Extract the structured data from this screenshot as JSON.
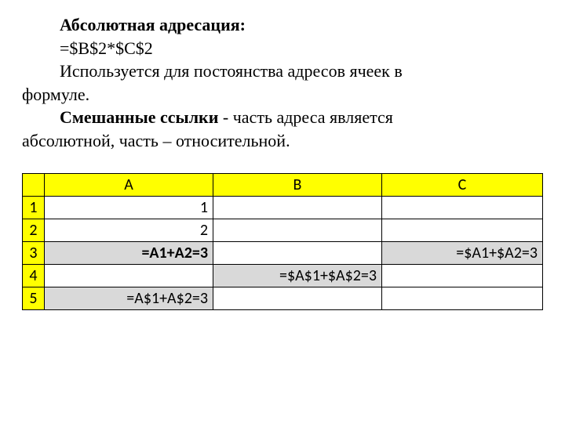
{
  "text": {
    "title": "Абсолютная адресация:",
    "formula_example": "=$B$2*$C$2",
    "p1a": "Используется для постоянства адресов ячеек в",
    "p1b": "формуле.",
    "p2a_bold": "Смешанные ссылки",
    "p2a_rest": " - часть адреса является",
    "p2b": "абсолютной, часть – относительной."
  },
  "table": {
    "cols": {
      "a": "A",
      "b": "B",
      "c": "C"
    },
    "rows": {
      "r1": "1",
      "r2": "2",
      "r3": "3",
      "r4": "4",
      "r5": "5"
    },
    "cells": {
      "a1": "1",
      "a2": "2",
      "a3": "=A1+A2=3",
      "c3": "=$A1+$A2=3",
      "b4": "=$A$1+$A$2=3",
      "a5": "=A$1+A$2=3"
    }
  }
}
